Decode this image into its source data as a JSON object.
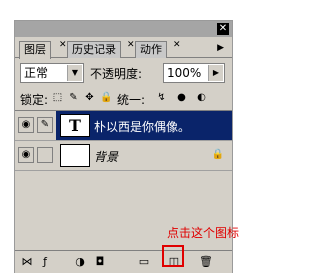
{
  "tabs": [
    {
      "label": "图层"
    },
    {
      "label": "历史记录"
    },
    {
      "label": "动作"
    }
  ],
  "blend_mode": "正常",
  "opacity_label": "不透明度:",
  "opacity_value": "100%",
  "lock_label": "锁定:",
  "unify_label": "统一:",
  "layers": [
    {
      "thumb_text": "T",
      "name": "朴以西是你偶像。",
      "selected": true
    },
    {
      "thumb_text": "",
      "name": "背景",
      "selected": false
    }
  ],
  "annotation": "点击这个图标",
  "colors": {
    "highlight": "#e00000",
    "selected": "#0a246a"
  }
}
